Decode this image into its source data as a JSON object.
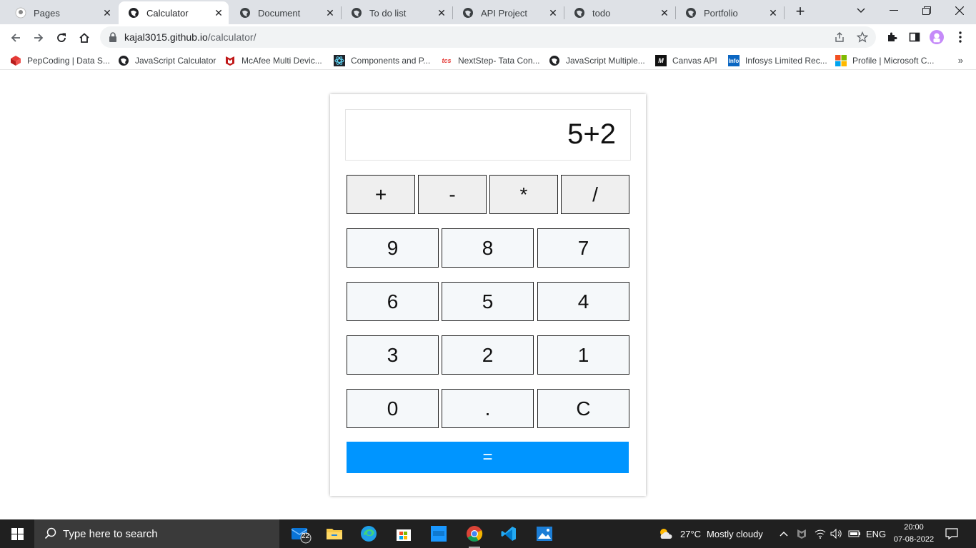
{
  "browser": {
    "tabs": [
      {
        "title": "Pages",
        "icon": "github-icon",
        "active": false
      },
      {
        "title": "Calculator",
        "icon": "globe-icon",
        "active": true
      },
      {
        "title": "Document",
        "icon": "globe-icon",
        "active": false
      },
      {
        "title": "To do list",
        "icon": "globe-icon",
        "active": false
      },
      {
        "title": "API Project",
        "icon": "globe-icon",
        "active": false
      },
      {
        "title": "todo",
        "icon": "globe-icon",
        "active": false
      },
      {
        "title": "Portfolio",
        "icon": "globe-icon",
        "active": false
      }
    ],
    "url": {
      "host": "kajal3015.github.io",
      "path": "/calculator/"
    },
    "bookmarks": [
      {
        "label": "PepCoding | Data S...",
        "icon": "pepcoding-icon"
      },
      {
        "label": "JavaScript Calculator",
        "icon": "globe-icon"
      },
      {
        "label": "McAfee Multi Devic...",
        "icon": "mcafee-icon"
      },
      {
        "label": "Components and P...",
        "icon": "react-icon"
      },
      {
        "label": "NextStep- Tata Con...",
        "icon": "tcs-icon"
      },
      {
        "label": "JavaScript Multiple...",
        "icon": "globe-icon"
      },
      {
        "label": "Canvas API",
        "icon": "mdn-icon"
      },
      {
        "label": "Infosys Limited Rec...",
        "icon": "infosys-icon"
      },
      {
        "label": "Profile | Microsoft C...",
        "icon": "microsoft-icon"
      }
    ],
    "bookmarks_more": "»"
  },
  "calculator": {
    "display": "5+2",
    "operators": [
      "+",
      "-",
      "*",
      "/"
    ],
    "digits": [
      [
        "9",
        "8",
        "7"
      ],
      [
        "6",
        "5",
        "4"
      ],
      [
        "3",
        "2",
        "1"
      ],
      [
        "0",
        ".",
        "C"
      ]
    ],
    "equals": "=",
    "colors": {
      "equals_bg": "#0095ff",
      "operator_bg": "#efefef",
      "digit_bg": "#f5f8fa"
    }
  },
  "taskbar": {
    "search_placeholder": "Type here to search",
    "mail_badge": "22",
    "weather": {
      "temp": "27°C",
      "condition": "Mostly cloudy"
    },
    "language": "ENG",
    "time": "20:00",
    "date": "07-08-2022"
  }
}
